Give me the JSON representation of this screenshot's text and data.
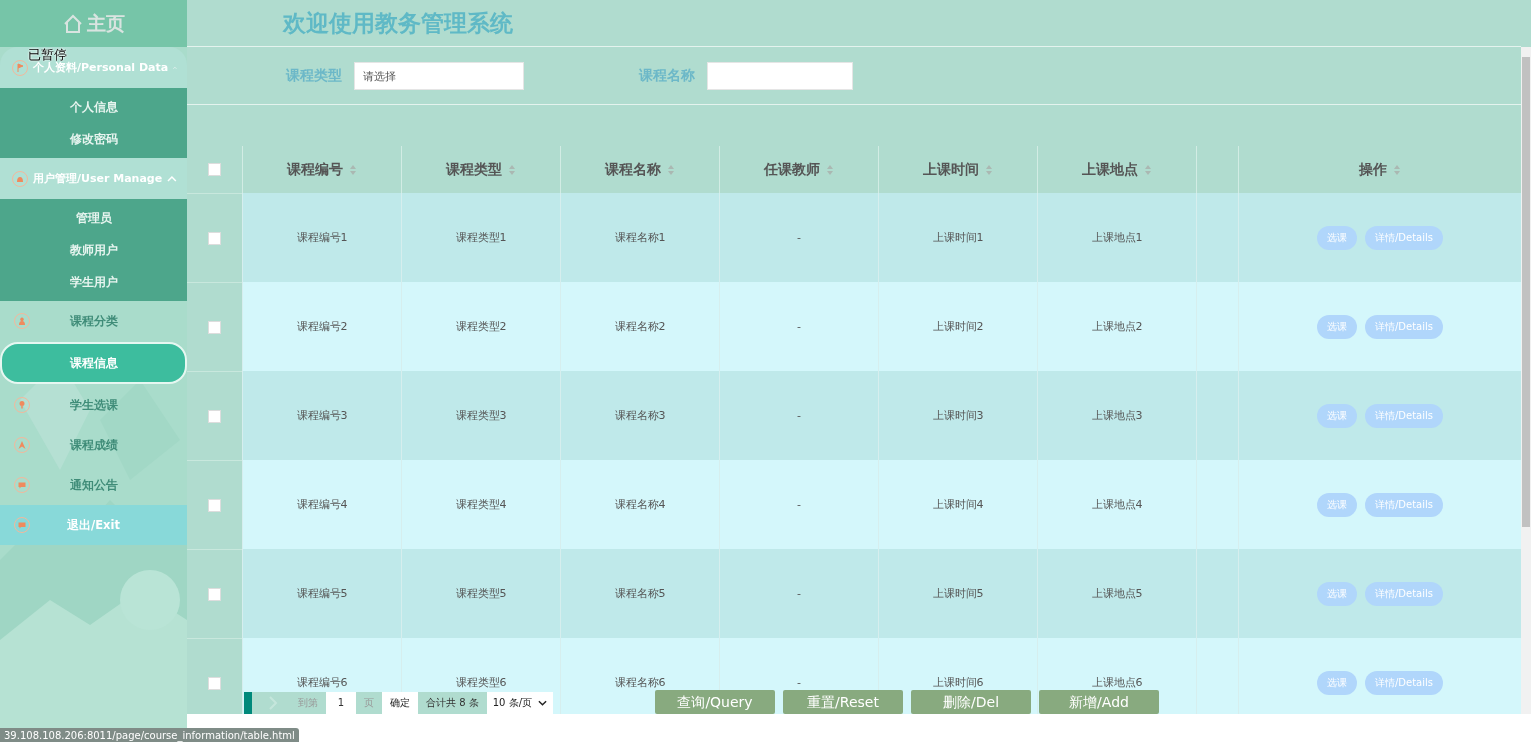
{
  "sidebar": {
    "home": "主页",
    "overlay_note": "已暂停",
    "menu": [
      {
        "kind": "group",
        "label": "个人资料/Personal Data",
        "expanded": true,
        "children": [
          {
            "label": "个人信息"
          },
          {
            "label": "修改密码"
          }
        ]
      },
      {
        "kind": "group",
        "label": "用户管理/User Manage",
        "expanded": true,
        "children": [
          {
            "label": "管理员"
          },
          {
            "label": "教师用户"
          },
          {
            "label": "学生用户"
          }
        ]
      },
      {
        "kind": "item",
        "label": "课程分类",
        "selected": false
      },
      {
        "kind": "item",
        "label": "课程信息",
        "selected": true
      },
      {
        "kind": "item",
        "label": "学生选课",
        "selected": false
      },
      {
        "kind": "item",
        "label": "课程成绩",
        "selected": false
      },
      {
        "kind": "item",
        "label": "通知公告",
        "selected": false
      },
      {
        "kind": "exit",
        "label": "退出/Exit",
        "selected": false
      }
    ]
  },
  "header": {
    "title": "欢迎使用教务管理系统"
  },
  "search": [
    {
      "label": "课程类型",
      "placeholder": "请选择"
    },
    {
      "label": "课程名称"
    }
  ],
  "table": {
    "select_all": false,
    "columns": [
      "课程编号",
      "课程类型",
      "课程名称",
      "任课教师",
      "上课时间",
      "上课地点",
      "操作"
    ],
    "rows": [
      {
        "checked": false,
        "cells": [
          "课程编号1",
          "课程类型1",
          "课程名称1",
          "-",
          "上课时间1",
          "上课地点1"
        ],
        "actions": [
          "选课",
          "详情/Details"
        ]
      },
      {
        "checked": false,
        "cells": [
          "课程编号2",
          "课程类型2",
          "课程名称2",
          "-",
          "上课时间2",
          "上课地点2"
        ],
        "actions": [
          "选课",
          "详情/Details"
        ]
      },
      {
        "checked": false,
        "cells": [
          "课程编号3",
          "课程类型3",
          "课程名称3",
          "-",
          "上课时间3",
          "上课地点3"
        ],
        "actions": [
          "选课",
          "详情/Details"
        ]
      },
      {
        "checked": false,
        "cells": [
          "课程编号4",
          "课程类型4",
          "课程名称4",
          "-",
          "上课时间4",
          "上课地点4"
        ],
        "actions": [
          "选课",
          "详情/Details"
        ]
      },
      {
        "checked": false,
        "cells": [
          "课程编号5",
          "课程类型5",
          "课程名称5",
          "-",
          "上课时间5",
          "上课地点5"
        ],
        "actions": [
          "选课",
          "详情/Details"
        ]
      },
      {
        "checked": false,
        "cells": [
          "课程编号6",
          "课程类型6",
          "课程名称6",
          "-",
          "上课时间6",
          "上课地点6"
        ],
        "actions": [
          "选课",
          "详情/Details"
        ]
      }
    ]
  },
  "pagination": {
    "goto_label": "到第",
    "page": "1",
    "page_unit": "页",
    "confirm": "确定",
    "total": "合计共 8 条",
    "page_size": "10 条/页"
  },
  "buttons": [
    "查询/Query",
    "重置/Reset",
    "删除/Del",
    "新增/Add"
  ],
  "status_url": "39.108.108.206:8011/page/course_information/table.html"
}
